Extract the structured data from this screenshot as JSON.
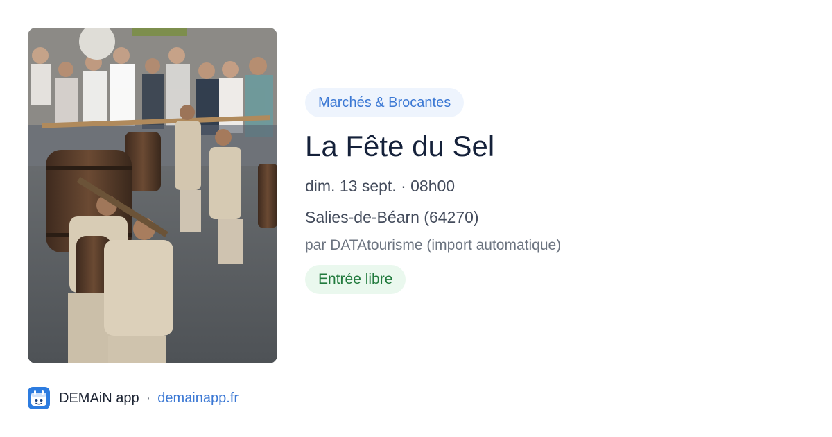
{
  "event": {
    "category": "Marchés & Brocantes",
    "title": "La Fête du Sel",
    "datetime": "dim. 13 sept. · 08h00",
    "location": "Salies-de-Béarn (64270)",
    "source": "par DATAtourisme (import automatique)",
    "price": "Entrée libre",
    "photo_icon": "event-photo"
  },
  "footer": {
    "app_name": "DEMAiN app",
    "separator": "·",
    "url": "demainapp.fr",
    "logo_icon": "demain-app-logo-icon"
  },
  "colors": {
    "category_text": "#3b78d4",
    "category_bg": "#eef4fd",
    "price_text": "#217a3d",
    "price_bg": "#eaf8ee",
    "title": "#15213a",
    "link": "#3b78d4",
    "logo_bg": "#2d7ce0"
  }
}
